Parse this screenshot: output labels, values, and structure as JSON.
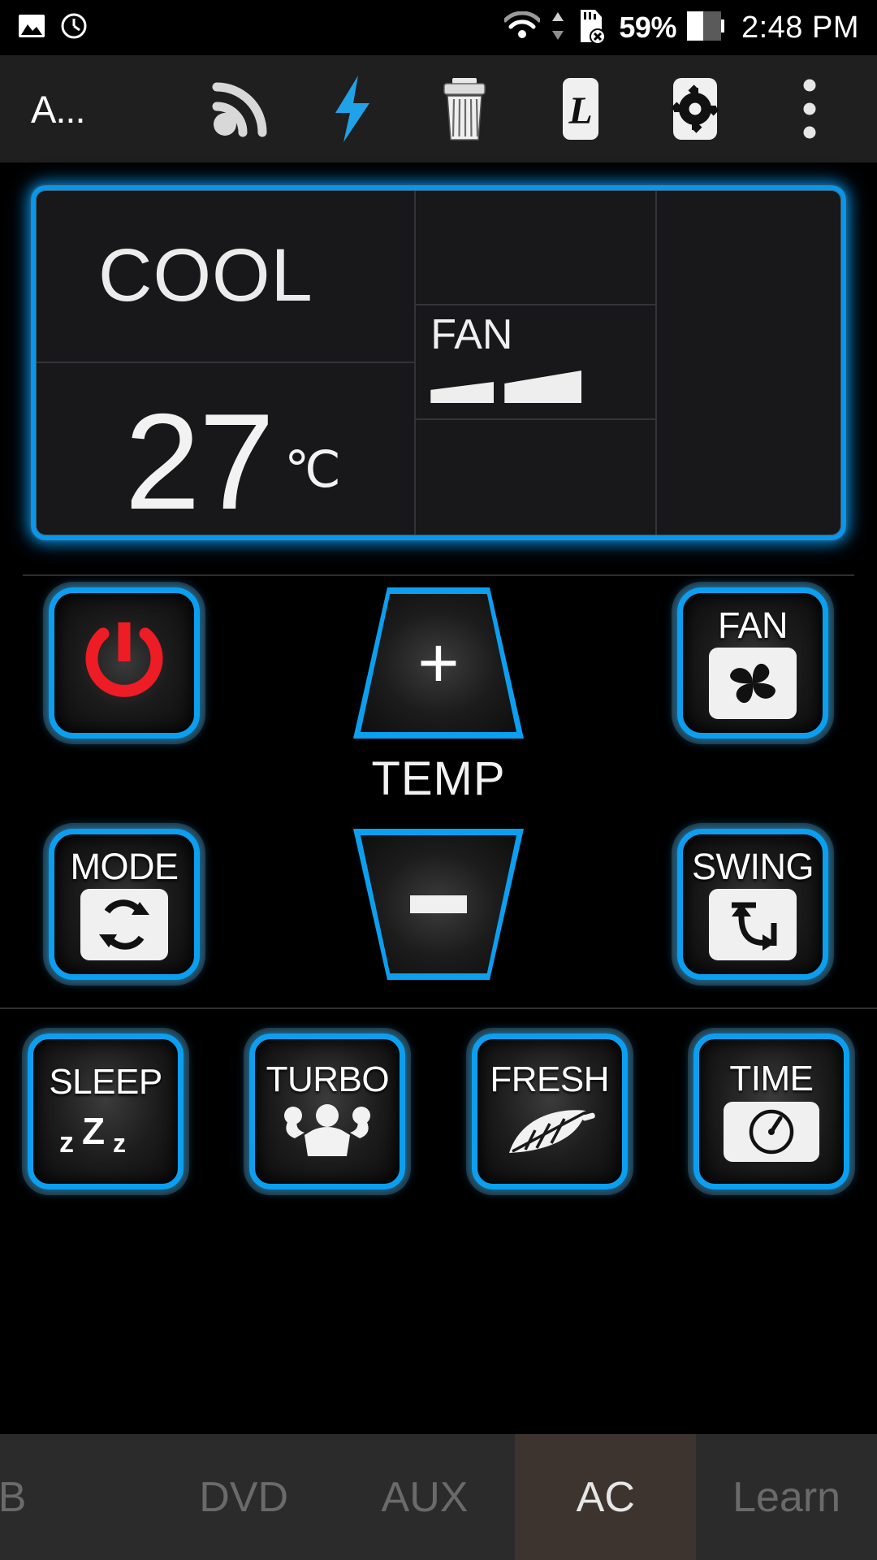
{
  "statusbar": {
    "icons": [
      "gallery-icon",
      "dashclock-icon",
      "wifi-icon",
      "data-transfer-icon",
      "sdcard-error-icon",
      "battery-icon"
    ],
    "battery_percent": "59%",
    "time": "2:48 PM"
  },
  "toolbar": {
    "title": "A...",
    "icons": [
      {
        "name": "rss-icon",
        "label": "Signal"
      },
      {
        "name": "flash-icon",
        "label": "Flash"
      },
      {
        "name": "trash-icon",
        "label": "Delete"
      },
      {
        "name": "learn-l-icon",
        "label": "L"
      },
      {
        "name": "gear-icon",
        "label": "Settings"
      },
      {
        "name": "overflow-menu-icon",
        "label": "More"
      }
    ]
  },
  "lcd": {
    "mode": "COOL",
    "temperature": "27",
    "unit": "℃",
    "fan_label": "FAN",
    "fan_level": 2
  },
  "controls": {
    "power_label": "Power",
    "temp_up_label": "+",
    "temp_down_label": "–",
    "temp_caption": "TEMP",
    "fan_label": "FAN",
    "mode_label": "MODE",
    "swing_label": "SWING"
  },
  "functions": [
    {
      "label": "SLEEP",
      "icon": "zzz-icon",
      "sub": "zZz"
    },
    {
      "label": "TURBO",
      "icon": "muscle-icon",
      "sub": ""
    },
    {
      "label": "FRESH",
      "icon": "leaf-icon",
      "sub": ""
    },
    {
      "label": "TIME",
      "icon": "timer-icon",
      "sub": ""
    }
  ],
  "tabs": [
    {
      "label": "TB",
      "active": false
    },
    {
      "label": "DVD",
      "active": false
    },
    {
      "label": "AUX",
      "active": false
    },
    {
      "label": "AC",
      "active": true
    },
    {
      "label": "Learn",
      "active": false
    }
  ],
  "colors": {
    "accent_blue": "#0c9ff0",
    "power_red": "#ee1c25",
    "active_tab_bg": "#3d332f",
    "panel_bg": "#18181a"
  }
}
